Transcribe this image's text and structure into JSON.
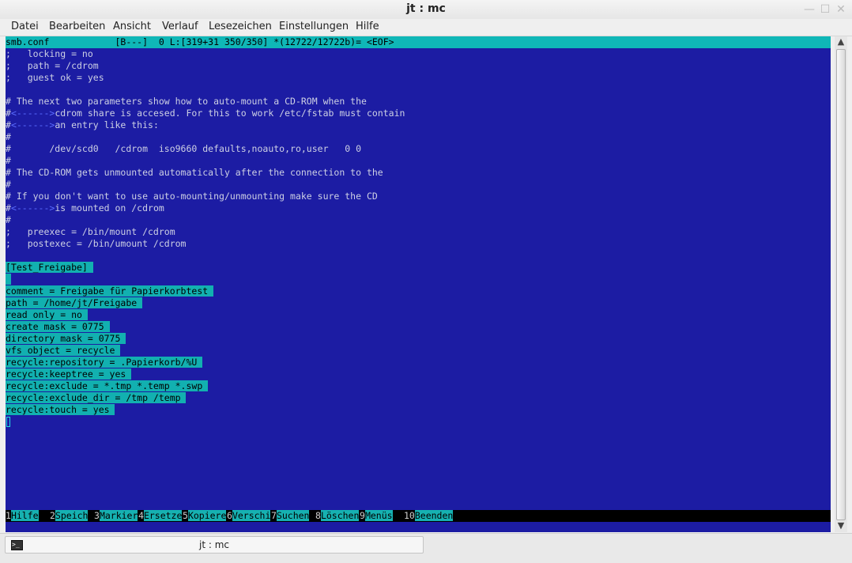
{
  "window": {
    "title": "jt : mc"
  },
  "menubar": {
    "items": [
      "Datei",
      "Bearbeiten",
      "Ansicht",
      "Verlauf",
      "Lesezeichen",
      "Einstellungen",
      "Hilfe"
    ]
  },
  "editor": {
    "status": "smb.conf            [B---]  0 L:[319+31 350/350] *(12722/12722b)= <EOF>",
    "lines": [
      {
        "text": ";   locking = no"
      },
      {
        "text": ";   path = /cdrom"
      },
      {
        "text": ";   guest ok = yes"
      },
      {
        "text": ""
      },
      {
        "text": "# The next two parameters show how to auto-mount a CD-ROM when the"
      },
      {
        "text": "#",
        "tab": "<------>",
        "rest": "cdrom share is accesed. For this to work /etc/fstab must contain"
      },
      {
        "text": "#",
        "tab": "<------>",
        "rest": "an entry like this:"
      },
      {
        "text": "#"
      },
      {
        "text": "#       /dev/scd0   /cdrom  iso9660 defaults,noauto,ro,user   0 0"
      },
      {
        "text": "#"
      },
      {
        "text": "# The CD-ROM gets unmounted automatically after the connection to the"
      },
      {
        "text": "#"
      },
      {
        "text": "# If you don't want to use auto-mounting/unmounting make sure the CD"
      },
      {
        "text": "#",
        "tab": "<------>",
        "rest": "is mounted on /cdrom"
      },
      {
        "text": "#"
      },
      {
        "text": ";   preexec = /bin/mount /cdrom"
      },
      {
        "text": ";   postexec = /bin/umount /cdrom"
      },
      {
        "text": ""
      },
      {
        "text": "[Test_Freigabe] ",
        "hl": true
      },
      {
        "text": " ",
        "hl": true
      },
      {
        "text": "comment = Freigabe für Papierkorbtest ",
        "hl": true
      },
      {
        "text": "path = /home/jt/Freigabe ",
        "hl": true
      },
      {
        "text": "read only = no ",
        "hl": true
      },
      {
        "text": "create mask = 0775 ",
        "hl": true
      },
      {
        "text": "directory mask = 0775 ",
        "hl": true
      },
      {
        "text": "vfs object = recycle ",
        "hl": true
      },
      {
        "text": "recycle:repository = .Papierkorb/%U ",
        "hl": true
      },
      {
        "text": "recycle:keeptree = yes ",
        "hl": true
      },
      {
        "text": "recycle:exclude = *.tmp *.temp *.swp ",
        "hl": true
      },
      {
        "text": "recycle:exclude_dir = /tmp /temp ",
        "hl": true
      },
      {
        "text": "recycle:touch = yes ",
        "hl": true
      }
    ]
  },
  "fkeys": [
    {
      "num": "1",
      "label": "Hilfe"
    },
    {
      "num": "2",
      "label": "Speich"
    },
    {
      "num": "3",
      "label": "Markier"
    },
    {
      "num": "4",
      "label": "Ersetze"
    },
    {
      "num": "5",
      "label": "Kopiere"
    },
    {
      "num": "6",
      "label": "Verschi"
    },
    {
      "num": "7",
      "label": "Suchen"
    },
    {
      "num": "8",
      "label": "Löschen"
    },
    {
      "num": "9",
      "label": "Menüs"
    },
    {
      "num": "10",
      "label": "Beenden"
    }
  ],
  "taskbar": {
    "task_label": "jt : mc"
  },
  "icons": {
    "terminal": "terminal-icon",
    "scroll_up": "scroll-up-icon",
    "scroll_down": "scroll-down-icon"
  }
}
